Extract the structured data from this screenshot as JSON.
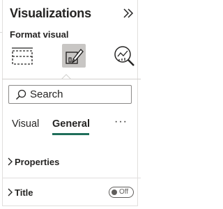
{
  "pane": {
    "title": "Visualizations",
    "subtitle": "Format visual"
  },
  "icons": {
    "collapse": "chevron-double-right-icon",
    "build": "build-visual-icon",
    "format": "format-visual-icon",
    "analytics": "analytics-icon",
    "search": "search-icon"
  },
  "search": {
    "placeholder": "Search"
  },
  "tabs": [
    {
      "label": "Visual",
      "selected": false
    },
    {
      "label": "General",
      "selected": true
    }
  ],
  "more_label": "···",
  "sections": [
    {
      "label": "Properties",
      "expanded": false
    },
    {
      "label": "Title",
      "expanded": false,
      "toggle": {
        "state": "Off",
        "on": false
      }
    }
  ],
  "colors": {
    "accent": "#1f6e5a",
    "selected_icon_bg": "#c8c6c4"
  }
}
